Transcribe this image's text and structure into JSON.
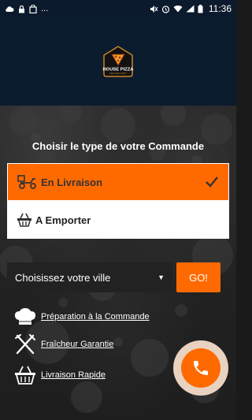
{
  "status_bar": {
    "dots": "...",
    "time": "11:36"
  },
  "logo": {
    "name": "HOUSE PIZZA",
    "tagline": "PIZZA DELIVERY"
  },
  "order_type": {
    "title": "Choisir le type de votre Commande",
    "options": [
      {
        "label": "En Livraison",
        "selected": true
      },
      {
        "label": "A Emporter",
        "selected": false
      }
    ]
  },
  "city": {
    "selected": "Choisissez votre ville",
    "go_label": "GO!"
  },
  "features": [
    {
      "label": "Préparation à la Commande",
      "icon": "chef-hat-icon"
    },
    {
      "label": "Fraîcheur Garantie",
      "icon": "fork-knife-icon"
    },
    {
      "label": "Livraison Rapide",
      "icon": "basket-icon"
    }
  ],
  "colors": {
    "accent": "#ff6a00",
    "header": "#0a1c2e",
    "fab_ring": "#e9d2c0"
  }
}
